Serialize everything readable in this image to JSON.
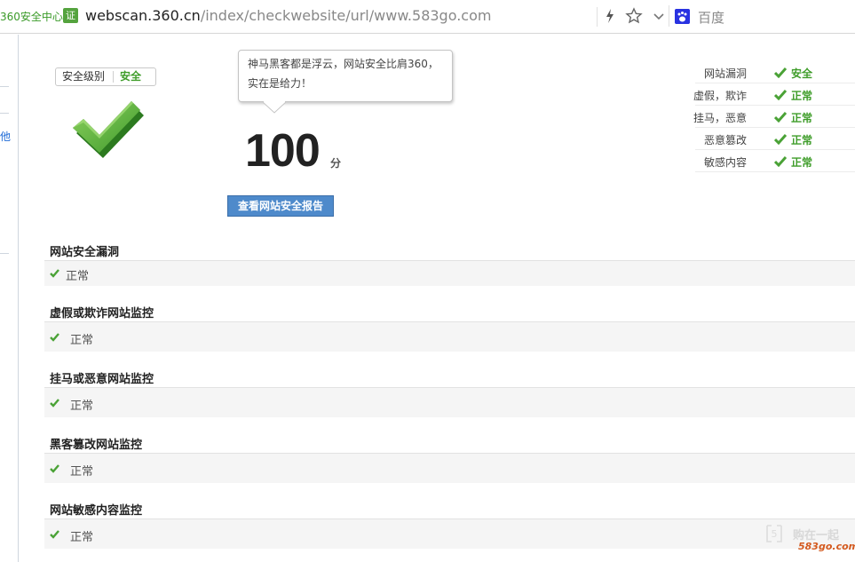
{
  "browser": {
    "site_label": "360安全中心",
    "cert_badge": "证",
    "url_domain": "webscan.360.cn",
    "url_path": "/index/checkwebsite/url/www.583go.com",
    "search_engine": "百度",
    "icons": [
      "bolt-icon",
      "star-icon",
      "chevron-down-icon",
      "baidu-paw-icon"
    ]
  },
  "sidebar": {
    "glyph": "他"
  },
  "rating": {
    "level_label": "安全级别",
    "level_value": "安全",
    "tooltip_line1": "神马黑客都是浮云，网站安全比肩360，",
    "tooltip_line2": "实在是给力！",
    "score": "100",
    "score_unit": "分",
    "report_button": "查看网站安全报告"
  },
  "status_list": [
    {
      "name": "网站漏洞",
      "value": "安全"
    },
    {
      "name": "虚假，欺诈",
      "value": "正常"
    },
    {
      "name": "挂马，恶意",
      "value": "正常"
    },
    {
      "name": "恶意篡改",
      "value": "正常"
    },
    {
      "name": "敏感内容",
      "value": "正常"
    }
  ],
  "sections": [
    {
      "title": "网站安全漏洞",
      "status": "正常"
    },
    {
      "title": "虚假或欺诈网站监控",
      "status": "正常"
    },
    {
      "title": "挂马或恶意网站监控",
      "status": "正常"
    },
    {
      "title": "黑客篡改网站监控",
      "status": "正常"
    },
    {
      "title": "网站敏感内容监控",
      "status": "正常"
    }
  ],
  "watermark": {
    "text": "购在一起",
    "url": "583go.com"
  },
  "colors": {
    "safe_green": "#3f9d2a",
    "button_blue": "#4e8acb",
    "row_bg": "#f5f5f5"
  }
}
